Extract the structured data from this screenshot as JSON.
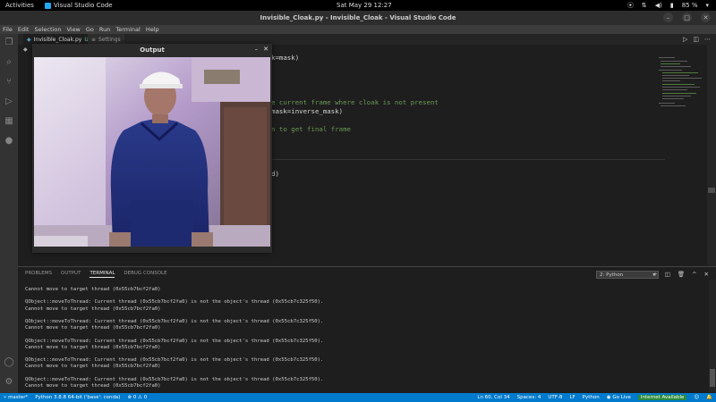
{
  "topbar": {
    "activities": "Activities",
    "app_name": "Visual Studio Code",
    "clock": "Sat May 29  12:27",
    "battery": "85 %"
  },
  "titlebar": {
    "title": "Invisible_Cloak.py - Invisible_Cloak - Visual Studio Code"
  },
  "menu": [
    "File",
    "Edit",
    "Selection",
    "View",
    "Go",
    "Run",
    "Terminal",
    "Help"
  ],
  "tabs": [
    {
      "label": "Invisible_Cloak.py",
      "suffix": "U"
    },
    {
      "label": "Settings"
    }
  ],
  "editor": {
    "lines": [
      {
        "text": "k=mask)",
        "kind": "plain"
      },
      {
        "text": "e current frame where cloak is not present",
        "kind": "comment"
      },
      {
        "text": "mask=inverse_mask)",
        "kind": "plain"
      },
      {
        "text": "n to get final frame",
        "kind": "comment"
      },
      {
        "text": "d)",
        "kind": "plain"
      }
    ]
  },
  "output_window": {
    "title": "Output"
  },
  "panel": {
    "tabs": [
      "PROBLEMS",
      "OUTPUT",
      "TERMINAL",
      "DEBUG CONSOLE"
    ],
    "active_tab": "TERMINAL",
    "terminal_select": "2: Python",
    "terminal_lines": [
      "Cannot move to target thread (0x55cb7bcf2fa0)",
      "",
      "QObject::moveToThread: Current thread (0x55cb7bcf2fa0) is not the object's thread (0x55cb7c325f50).",
      "Cannot move to target thread (0x55cb7bcf2fa0)",
      "",
      "QObject::moveToThread: Current thread (0x55cb7bcf2fa0) is not the object's thread (0x55cb7c325f50).",
      "Cannot move to target thread (0x55cb7bcf2fa0)",
      "",
      "QObject::moveToThread: Current thread (0x55cb7bcf2fa0) is not the object's thread (0x55cb7c325f50).",
      "Cannot move to target thread (0x55cb7bcf2fa0)",
      "",
      "QObject::moveToThread: Current thread (0x55cb7bcf2fa0) is not the object's thread (0x55cb7c325f50).",
      "Cannot move to target thread (0x55cb7bcf2fa0)",
      "",
      "QObject::moveToThread: Current thread (0x55cb7bcf2fa0) is not the object's thread (0x55cb7c325f50).",
      "Cannot move to target thread (0x55cb7bcf2fa0)"
    ]
  },
  "status": {
    "branch": "master*",
    "python": "Python 3.8.8 64-bit ('base': conda)",
    "errors": "0",
    "warnings": "0",
    "position": "Ln 60, Col 34",
    "spaces": "Spaces: 4",
    "encoding": "UTF-8",
    "eol": "LF",
    "language": "Python",
    "golive": "Go Live",
    "badge": "Internet Available"
  },
  "colors": {
    "accent": "#007acc",
    "comment": "#6a9955",
    "panel_bg": "#1e1e1e"
  }
}
